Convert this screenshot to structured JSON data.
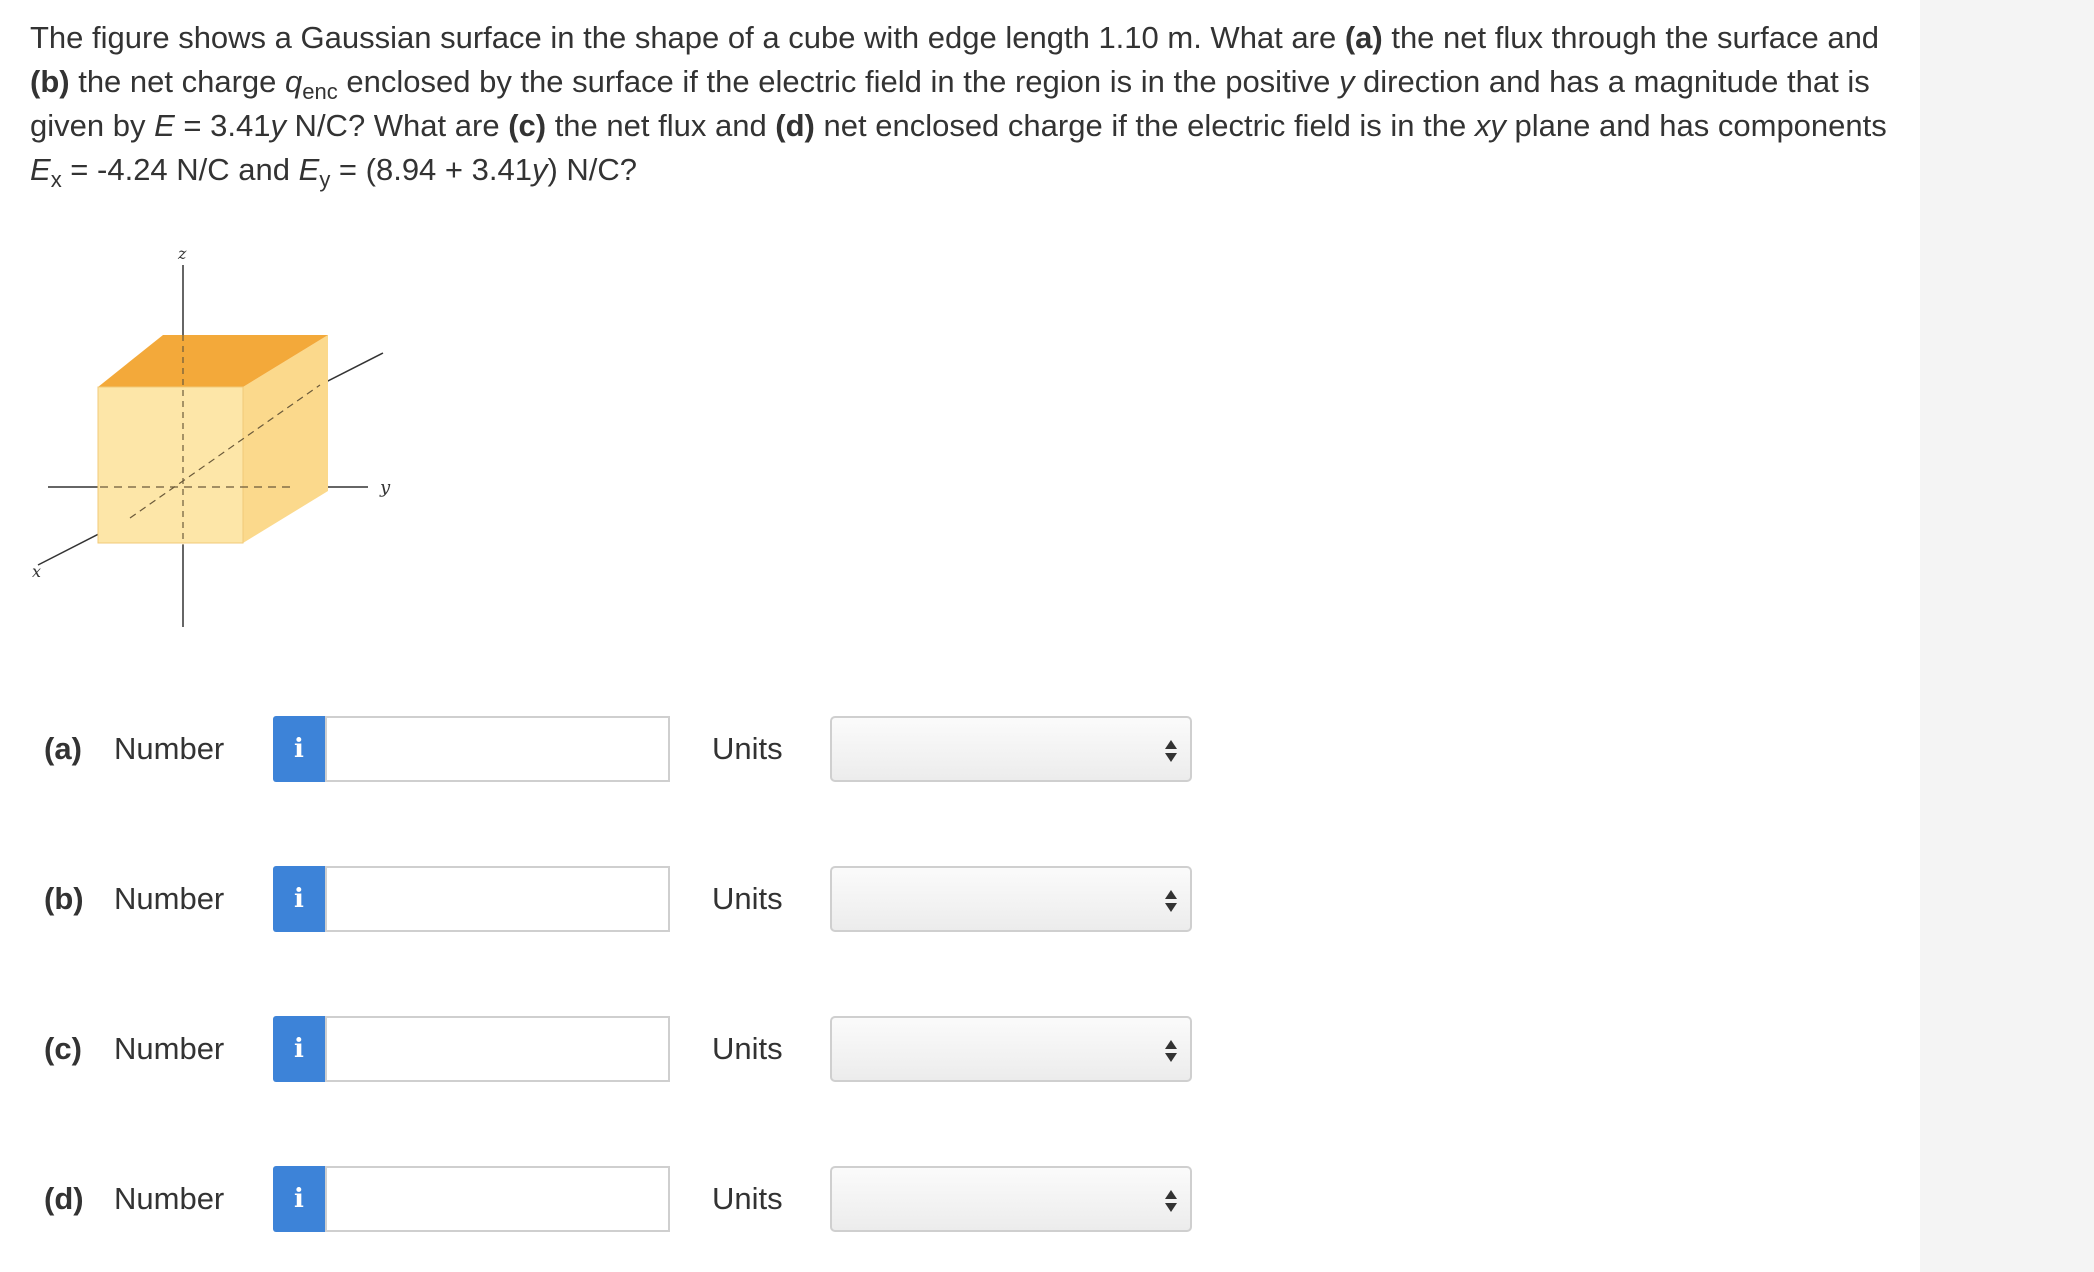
{
  "question": {
    "text_1": "The figure shows a Gaussian surface in the shape of a cube with edge length 1.10 m. What are ",
    "a_label": "(a)",
    "text_2": " the net flux through the surface and ",
    "b_label": "(b)",
    "text_3": " the net charge ",
    "q_symbol": "q",
    "q_subscript": "enc",
    "text_4": " enclosed by the surface if the electric field in the region is in the positive ",
    "y_var_1": "y",
    "text_5": " direction and has a magnitude that is given by ",
    "E_var": "E",
    "text_6": " = 3.41",
    "y_var_2": "y",
    "text_7": " N/C? What are ",
    "c_label": "(c)",
    "text_8": " the net flux and ",
    "d_label": "(d)",
    "text_9": " net enclosed charge if the electric field is in the ",
    "xy_var": "xy",
    "text_10": " plane and has components ",
    "Ex_var": "E",
    "Ex_sub": "x",
    "text_11": " = -4.24 N/C and ",
    "Ey_var": "E",
    "Ey_sub": "y",
    "text_12": " = (8.94 + 3.41",
    "y_var_3": "y",
    "text_13": ") N/C?"
  },
  "figure": {
    "z_label": "z",
    "y_label": "y",
    "x_label": "x",
    "cube_color": "#f6b94e"
  },
  "answers": [
    {
      "part": "(a)",
      "number_label": "Number",
      "info_icon": "i",
      "value": "",
      "units_label": "Units",
      "units_value": ""
    },
    {
      "part": "(b)",
      "number_label": "Number",
      "info_icon": "i",
      "value": "",
      "units_label": "Units",
      "units_value": ""
    },
    {
      "part": "(c)",
      "number_label": "Number",
      "info_icon": "i",
      "value": "",
      "units_label": "Units",
      "units_value": ""
    },
    {
      "part": "(d)",
      "number_label": "Number",
      "info_icon": "i",
      "value": "",
      "units_label": "Units",
      "units_value": ""
    }
  ],
  "colors": {
    "info_button": "#3d83d8",
    "input_border": "#cfcfcf",
    "text": "#333333"
  }
}
